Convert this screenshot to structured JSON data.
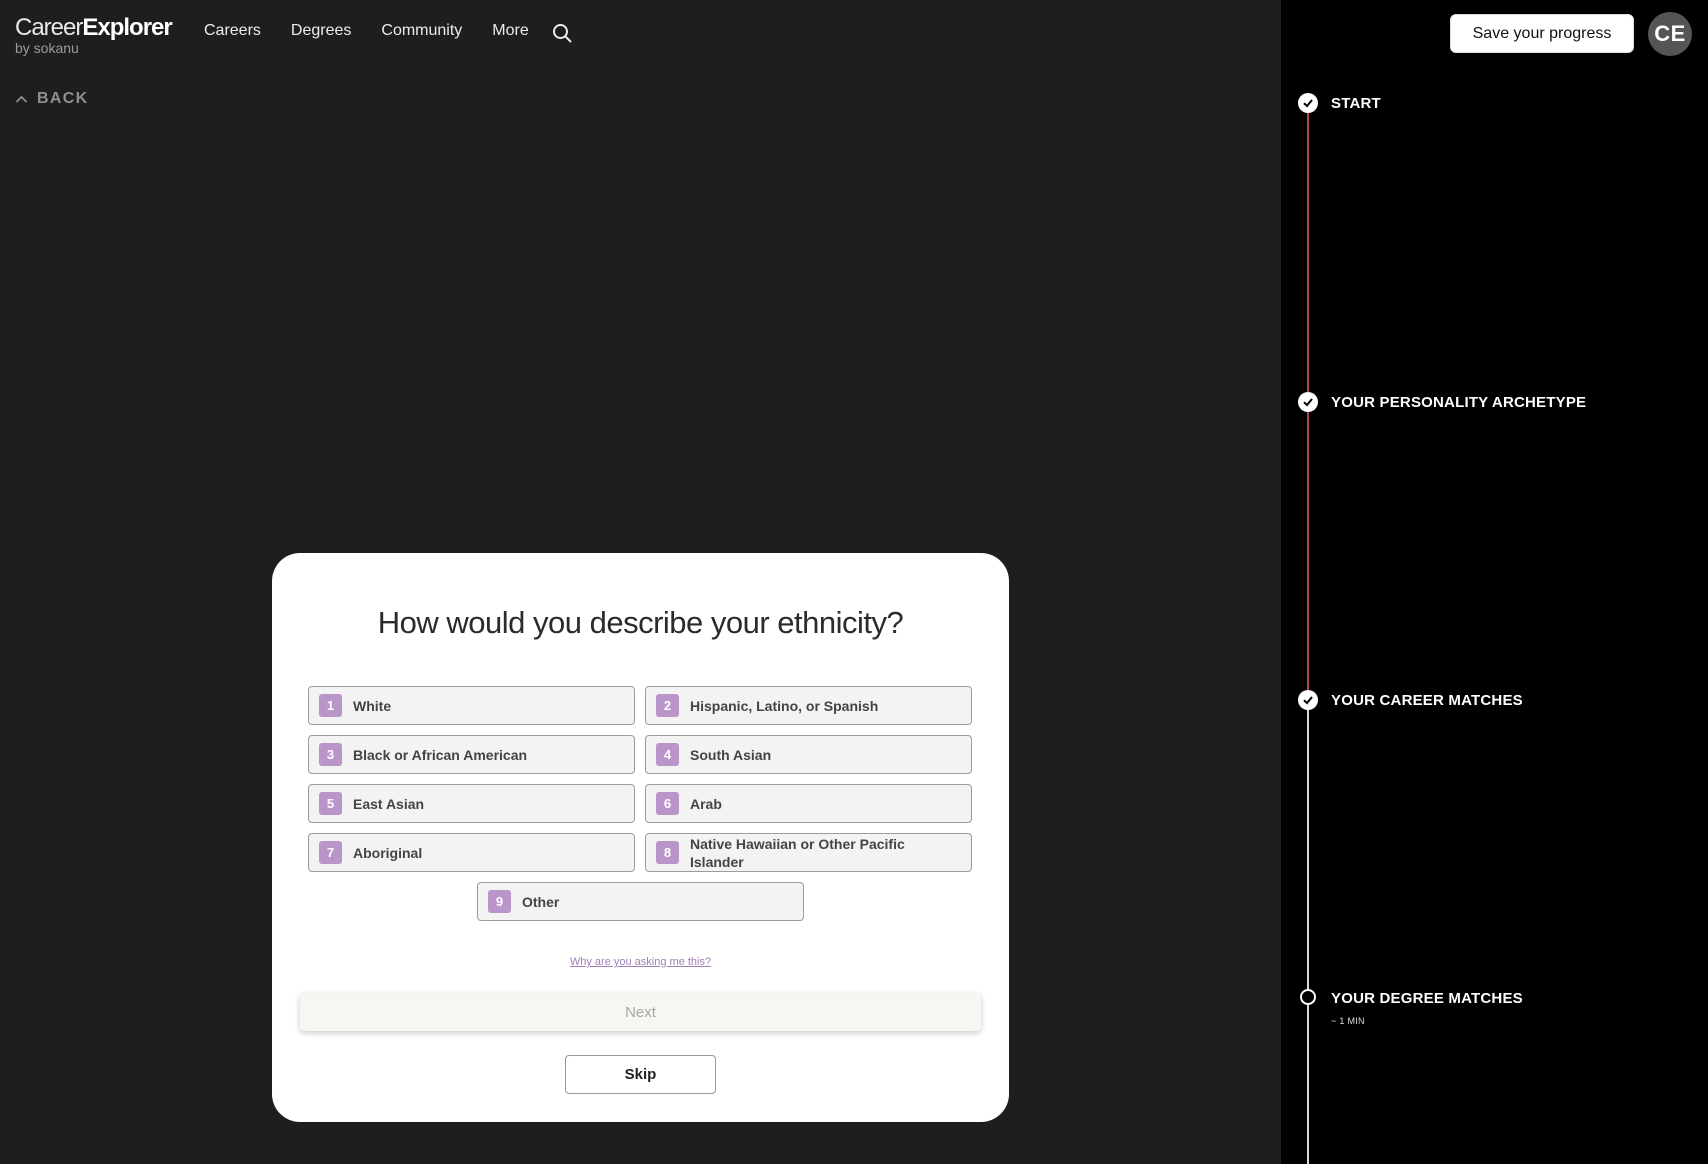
{
  "brand": {
    "part1": "Career",
    "part2": "Explorer",
    "sub": "by sokanu"
  },
  "nav": [
    {
      "label": "Careers"
    },
    {
      "label": "Degrees"
    },
    {
      "label": "Community"
    },
    {
      "label": "More"
    }
  ],
  "back_label": "BACK",
  "header_right": {
    "save_label": "Save your progress",
    "avatar_initials": "CE"
  },
  "steps": [
    {
      "label": "START",
      "done": true
    },
    {
      "label": "YOUR PERSONALITY ARCHETYPE",
      "done": true
    },
    {
      "label": "YOUR CAREER MATCHES",
      "done": true
    },
    {
      "label": "YOUR DEGREE MATCHES",
      "done": false,
      "sub": "~ 1 MIN"
    }
  ],
  "question": {
    "title": "How would you describe your ethnicity?",
    "options": [
      {
        "num": "1",
        "label": "White"
      },
      {
        "num": "2",
        "label": "Hispanic, Latino, or Spanish"
      },
      {
        "num": "3",
        "label": "Black or African American"
      },
      {
        "num": "4",
        "label": "South Asian"
      },
      {
        "num": "5",
        "label": "East Asian"
      },
      {
        "num": "6",
        "label": "Arab"
      },
      {
        "num": "7",
        "label": "Aboriginal"
      },
      {
        "num": "8",
        "label": "Native Hawaiian or Other Pacific Islander"
      },
      {
        "num": "9",
        "label": "Other"
      }
    ],
    "why_link": "Why are you asking me this?",
    "next_label": "Next",
    "skip_label": "Skip"
  },
  "colors": {
    "background": "#1e1e1e",
    "side_panel": "#000000",
    "accent_purple": "#b995c9",
    "progress_red": "#b3454f"
  },
  "icons": {
    "search": "search-icon",
    "back": "chevron-up-icon",
    "check": "check-icon"
  }
}
